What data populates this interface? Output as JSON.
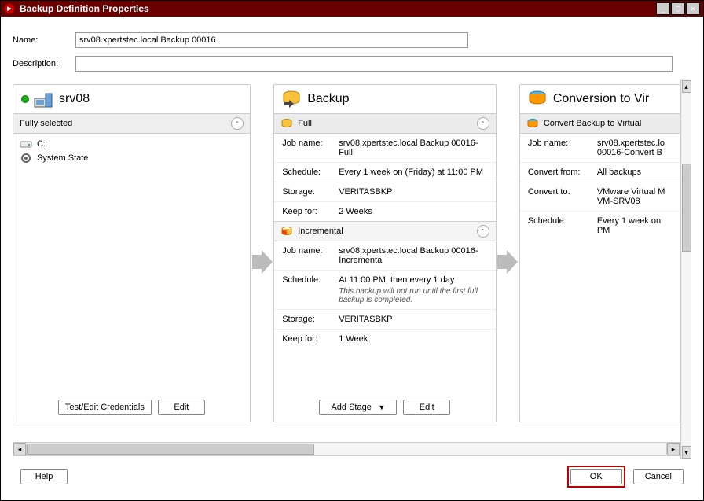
{
  "title": "Backup Definition Properties",
  "labels": {
    "name": "Name:",
    "description": "Description:"
  },
  "form": {
    "name_value": "srv08.xpertstec.local Backup 00016",
    "description_value": ""
  },
  "source": {
    "server": "srv08",
    "group_label": "Fully selected",
    "items": [
      {
        "label": "C:"
      },
      {
        "label": "System State"
      }
    ],
    "buttons": {
      "test_edit": "Test/Edit Credentials",
      "edit": "Edit"
    }
  },
  "backup": {
    "title": "Backup",
    "stages": [
      {
        "name": "Full",
        "rows": {
          "job_name_label": "Job name:",
          "job_name": "srv08.xpertstec.local Backup 00016-Full",
          "schedule_label": "Schedule:",
          "schedule": "Every 1 week on (Friday) at 11:00 PM",
          "storage_label": "Storage:",
          "storage": "VERITASBKP",
          "keep_label": "Keep for:",
          "keep": "2 Weeks"
        }
      },
      {
        "name": "Incremental",
        "rows": {
          "job_name_label": "Job name:",
          "job_name": "srv08.xpertstec.local Backup 00016-Incremental",
          "schedule_label": "Schedule:",
          "schedule": "At 11:00 PM, then every 1 day",
          "schedule_note": "This backup will not run until the first full backup is completed.",
          "storage_label": "Storage:",
          "storage": "VERITASBKP",
          "keep_label": "Keep for:",
          "keep": "1 Week"
        }
      }
    ],
    "buttons": {
      "add_stage": "Add Stage",
      "edit": "Edit"
    }
  },
  "convert": {
    "title": "Conversion to Vir",
    "stage_name": "Convert Backup to Virtual",
    "rows": {
      "job_name_label": "Job name:",
      "job_name": "srv08.xpertstec.lo 00016-Convert B",
      "convert_from_label": "Convert from:",
      "convert_from": "All backups",
      "convert_to_label": "Convert to:",
      "convert_to": "VMware Virtual M VM-SRV08",
      "schedule_label": "Schedule:",
      "schedule": "Every 1 week on PM"
    }
  },
  "bottom": {
    "help": "Help",
    "ok": "OK",
    "cancel": "Cancel"
  }
}
